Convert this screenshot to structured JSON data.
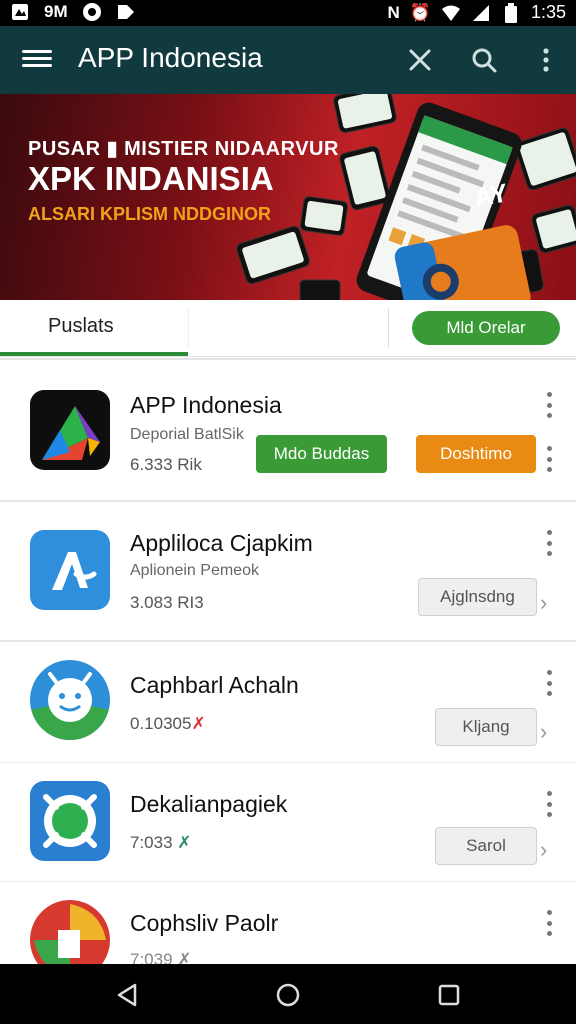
{
  "status_bar": {
    "left_text": "9M",
    "time": "1:35",
    "icons": [
      "notification-icon",
      "circle-app-icon",
      "tag-icon",
      "nfc-icon",
      "alarm-icon",
      "wifi-icon",
      "signal-icon",
      "battery-icon"
    ]
  },
  "app_bar": {
    "title": "APP Indonesia",
    "icons": [
      "menu-icon",
      "close-icon",
      "search-icon",
      "overflow-icon"
    ]
  },
  "banner": {
    "line1": "PUSAR ▮ MISTIER NIDAARVUR",
    "line2": "XPK INDANISIA",
    "line3": "ALSARI KPLISM NDDGINOR",
    "badge_text": "AY"
  },
  "tabs": {
    "active_tab": "Puslats",
    "action_button": "Mld Orelar"
  },
  "apps": [
    {
      "name": "APP Indonesia",
      "subtitle": "Deporial BatlSik",
      "size": "6.333 Rik",
      "primary_button": "Mdo Buddas",
      "secondary_button": "Doshtimo",
      "icon": "play-triangle-icon"
    },
    {
      "name": "Appliloca Cjapkim",
      "subtitle": "Aplionein Pemeok",
      "size": "3.083 RI3",
      "button": "Ajglnsdng",
      "icon": "phone-icon"
    },
    {
      "name": "Caphbarl Achaln",
      "size": "0.10305",
      "size_mark": "✗",
      "button": "Kljang",
      "icon": "smiley-icon"
    },
    {
      "name": "Dekalianpagiek",
      "size": "7:033",
      "size_mark": "✗",
      "button": "Sarol",
      "icon": "circle-badge-icon"
    },
    {
      "name": "Cophsliv Paolr",
      "size": "7:039 ✗",
      "icon": "red-circle-icon"
    }
  ],
  "colors": {
    "appbar": "#103a3d",
    "green": "#3a9a35",
    "orange": "#e98a12",
    "banner_red": "#c02125"
  }
}
